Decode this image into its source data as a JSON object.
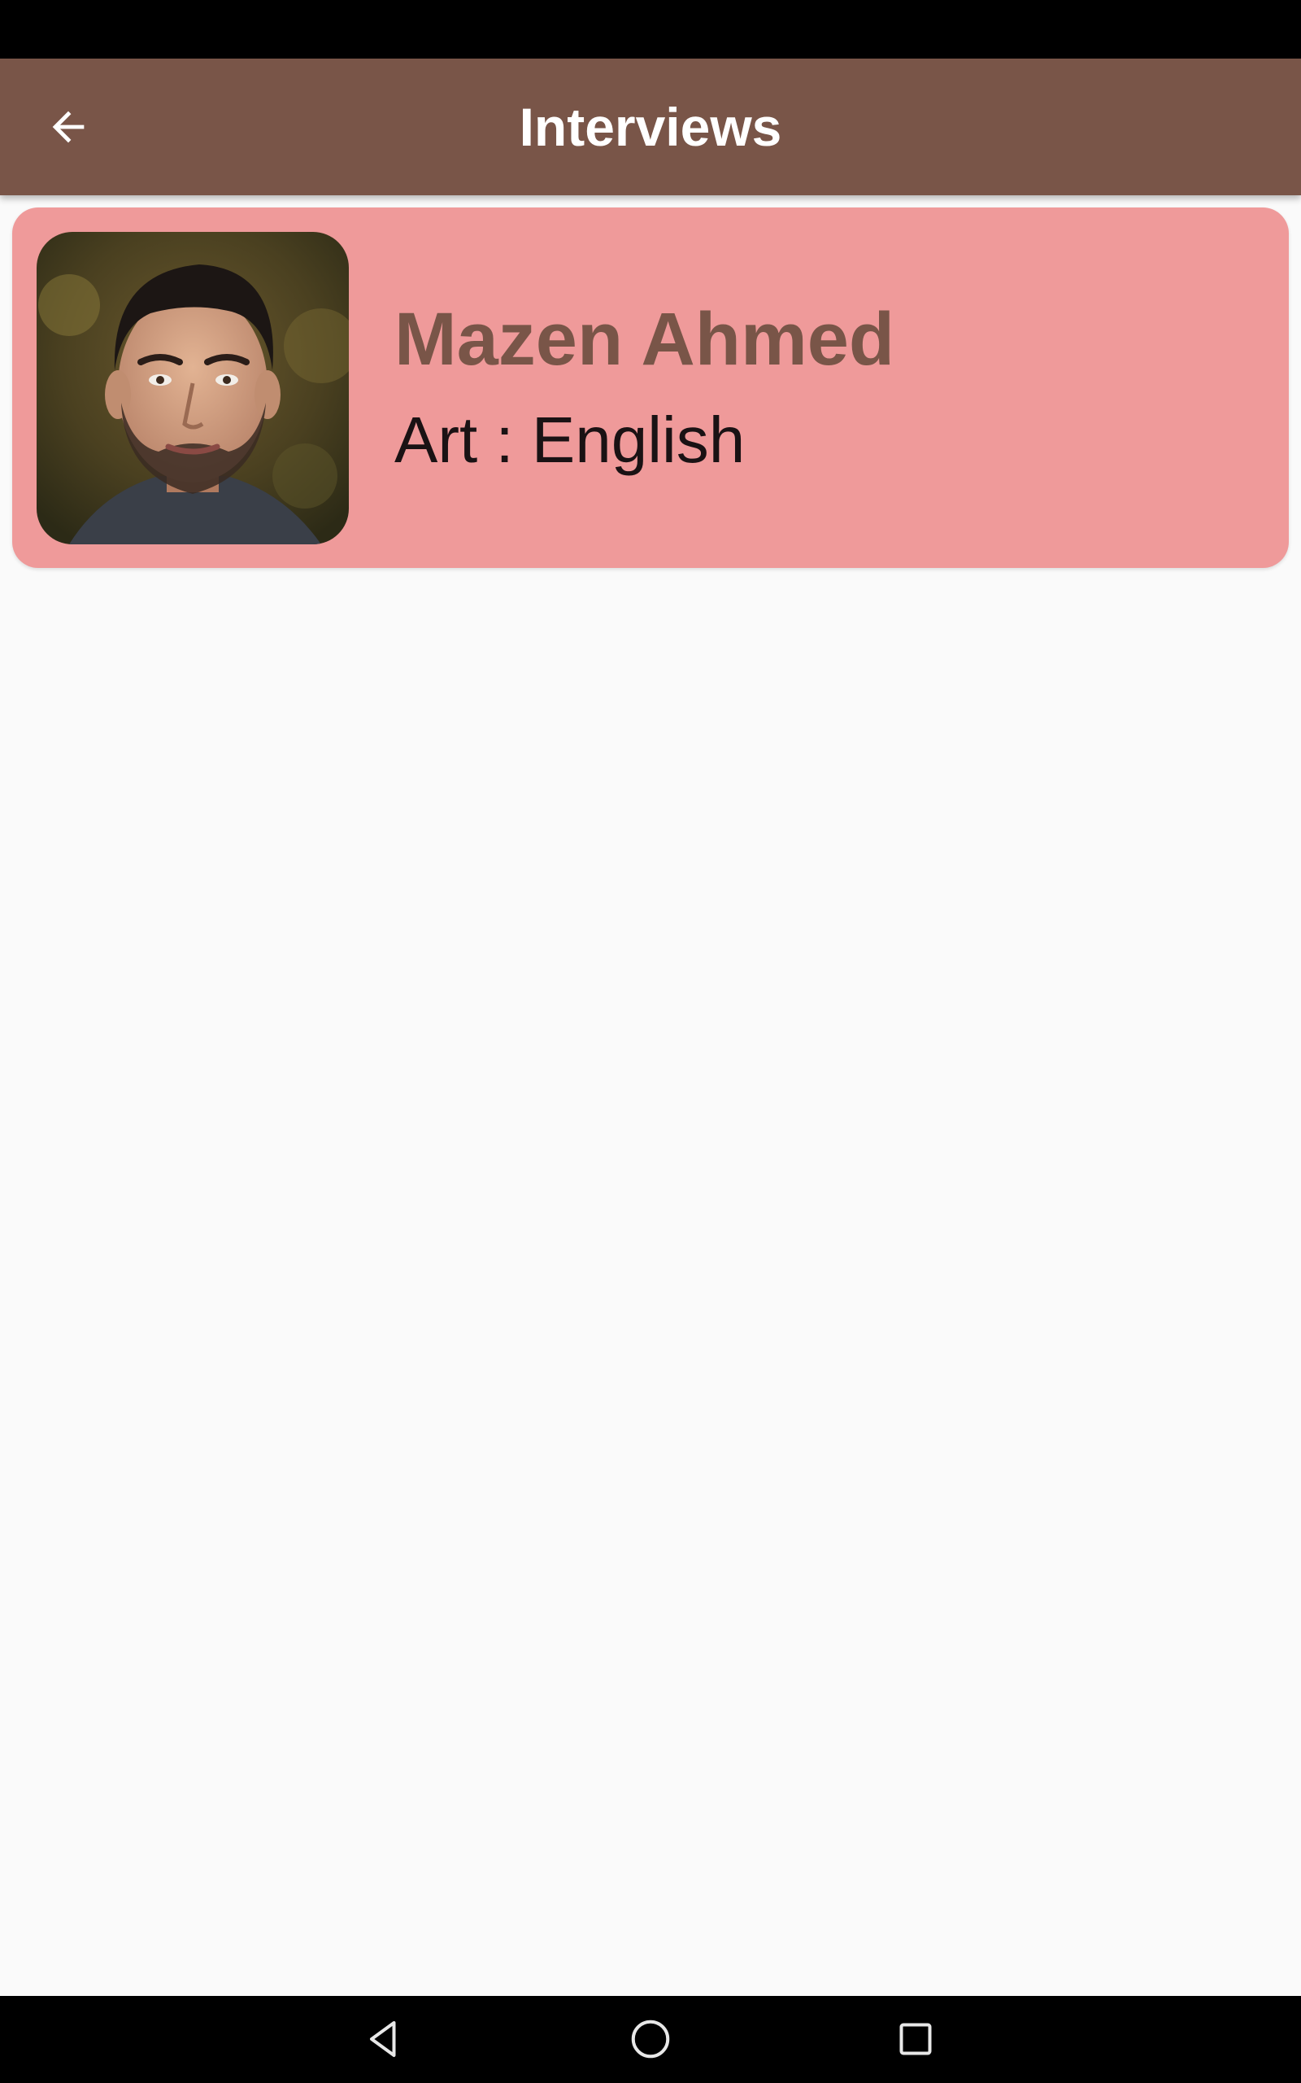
{
  "app_bar": {
    "title": "Interviews",
    "back_icon": "arrow-back-icon",
    "color": "#795548"
  },
  "interviews": [
    {
      "name": "Mazen Ahmed",
      "subject": "Art : English",
      "avatar_icon": "person-photo",
      "card_color": "#ef9a9a"
    }
  ],
  "nav_bar": {
    "icons": [
      "nav-back-icon",
      "nav-home-icon",
      "nav-recents-icon"
    ]
  }
}
